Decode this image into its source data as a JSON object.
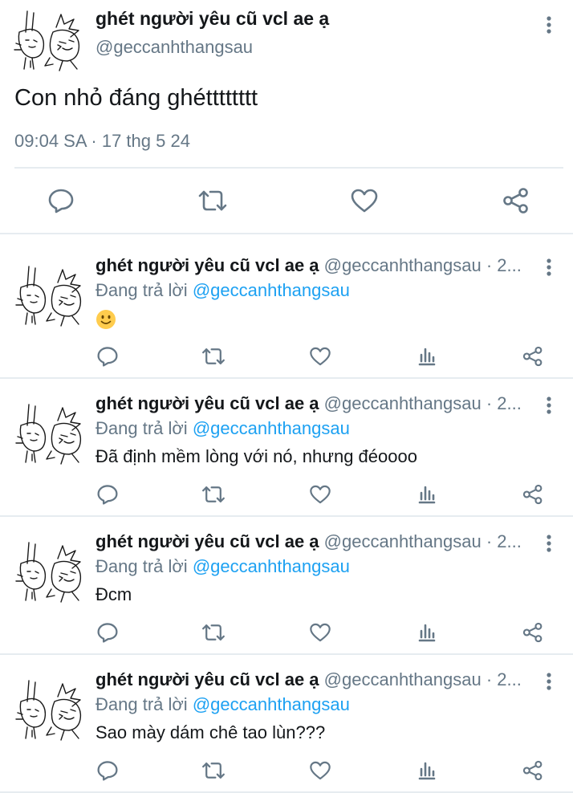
{
  "main_tweet": {
    "author_name": "ghét người yêu cũ vcl ae ạ",
    "author_handle": "@geccanhthangsau",
    "text": "Con nhỏ đáng ghétttttttt",
    "timestamp": "09:04 SA · 17 thg 5 24",
    "actions": [
      "reply-icon",
      "retweet-icon",
      "like-icon",
      "share-icon"
    ]
  },
  "replies": [
    {
      "author_name": "ghét người yêu cũ vcl ae ạ",
      "author_handle": "@geccanhthangsau",
      "separator": "·",
      "time": "2...",
      "replying_label": "Đang trả lời",
      "replying_to": "@geccanhthangsau",
      "text": "",
      "emoji": "slightly-smiling-face-emoji"
    },
    {
      "author_name": "ghét người yêu cũ vcl ae ạ",
      "author_handle": "@geccanhthangsau",
      "separator": "·",
      "time": "2...",
      "replying_label": "Đang trả lời",
      "replying_to": "@geccanhthangsau",
      "text": "Đã định mềm lòng với nó, nhưng đéoooo"
    },
    {
      "author_name": "ghét người yêu cũ vcl ae ạ",
      "author_handle": "@geccanhthangsau",
      "separator": "·",
      "time": "2...",
      "replying_label": "Đang trả lời",
      "replying_to": "@geccanhthangsau",
      "text": "Đcm"
    },
    {
      "author_name": "ghét người yêu cũ vcl ae ạ",
      "author_handle": "@geccanhthangsau",
      "separator": "·",
      "time": "2...",
      "replying_label": "Đang trả lời",
      "replying_to": "@geccanhthangsau",
      "text": "Sao mày dám chê tao lùn???"
    }
  ],
  "reply_actions": [
    "reply-icon",
    "retweet-icon",
    "like-icon",
    "analytics-icon",
    "share-icon"
  ],
  "colors": {
    "text": "#14171a",
    "secondary": "#657786",
    "link": "#1da1f2",
    "divider": "#e6ecf0",
    "emoji": "#ffcc4d"
  }
}
